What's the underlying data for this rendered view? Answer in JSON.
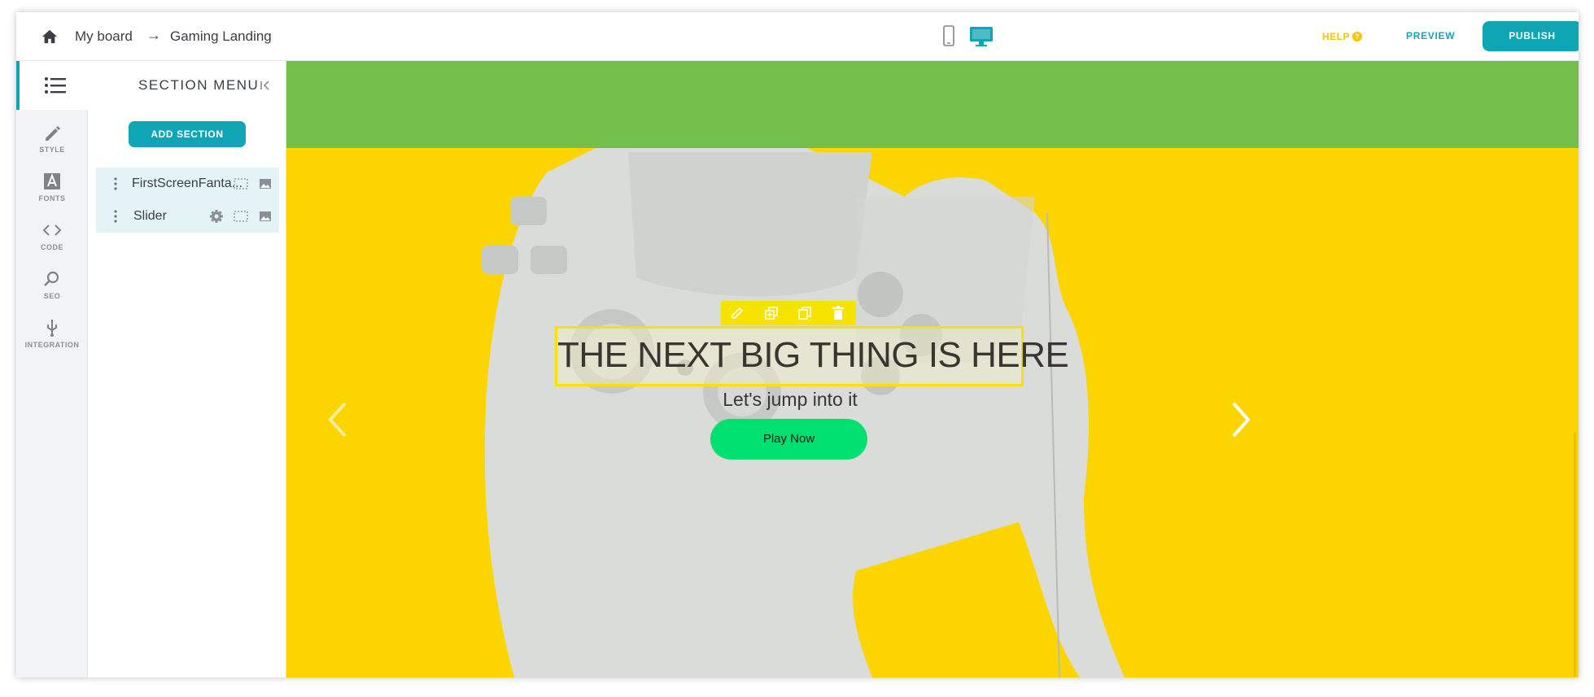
{
  "topbar": {
    "breadcrumb_board": "My board",
    "breadcrumb_arrow": "→",
    "breadcrumb_page": "Gaming Landing",
    "help_label": "HELP",
    "help_badge": "?",
    "preview_label": "PREVIEW",
    "publish_label": "PUBLISH",
    "active_device": "desktop"
  },
  "rail": {
    "items": [
      {
        "label": "STYLE",
        "icon": "pencil-icon"
      },
      {
        "label": "FONTS",
        "icon": "font-icon"
      },
      {
        "label": "CODE",
        "icon": "code-icon"
      },
      {
        "label": "SEO",
        "icon": "seo-search-icon"
      },
      {
        "label": "INTEGRATION",
        "icon": "plug-icon"
      }
    ]
  },
  "panel": {
    "title": "SECTION MENU",
    "add_section_label": "ADD SECTION",
    "sections": [
      {
        "name": "FirstScreenFanta...",
        "actions": [
          "resize-icon",
          "image-icon"
        ]
      },
      {
        "name": "Slider",
        "actions": [
          "gear-icon",
          "resize-icon",
          "image-icon"
        ]
      }
    ]
  },
  "hero": {
    "title": "THE NEXT BIG THING IS HERE",
    "subtitle": "Let's jump into it",
    "cta_label": "Play Now"
  },
  "colors": {
    "accent": "#0fa5b5",
    "help": "#f7c400",
    "green_band": "#72bf4c",
    "hero_bg": "#fcd400",
    "cta": "#00e070"
  }
}
